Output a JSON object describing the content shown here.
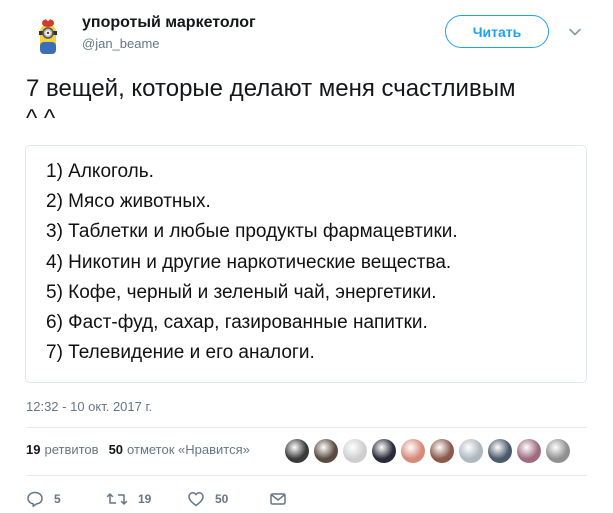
{
  "author": {
    "display_name": "упоротый маркетолог",
    "screen_name": "@jan_beame",
    "avatar_icon": "minion-avatar"
  },
  "follow_button": {
    "label": "Читать"
  },
  "tweet": {
    "text_line1": "7 вещей, которые делают меня счастливым",
    "text_line2": "^ ^"
  },
  "card": {
    "items": [
      "1) Алкоголь.",
      "2) Мясо животных.",
      "3) Таблетки и любые продукты фармацевтики.",
      "4) Никотин и другие наркотические вещества.",
      "5) Кофе, черный и зеленый чай, энергетики.",
      "6) Фаст-фуд, сахар, газированные напитки.",
      "7) Телевидение и его аналоги."
    ]
  },
  "timestamp": "12:32 - 10 окт. 2017 г.",
  "stats": {
    "retweets_count": "19",
    "retweets_label": "ретвитов",
    "likes_count": "50",
    "likes_label": "отметок «Нравится»"
  },
  "likers": [
    "#3a3a3a",
    "#5a4a40",
    "#cfcfcf",
    "#2a2a3a",
    "#d88a7a",
    "#8a5a4a",
    "#b0b8c0",
    "#4a5a6a",
    "#a06a80",
    "#909090"
  ],
  "actions": {
    "reply_count": "5",
    "retweet_count": "19",
    "like_count": "50"
  },
  "colors": {
    "accent": "#1da1f2",
    "muted": "#657786",
    "divider": "#e6ecf0"
  }
}
